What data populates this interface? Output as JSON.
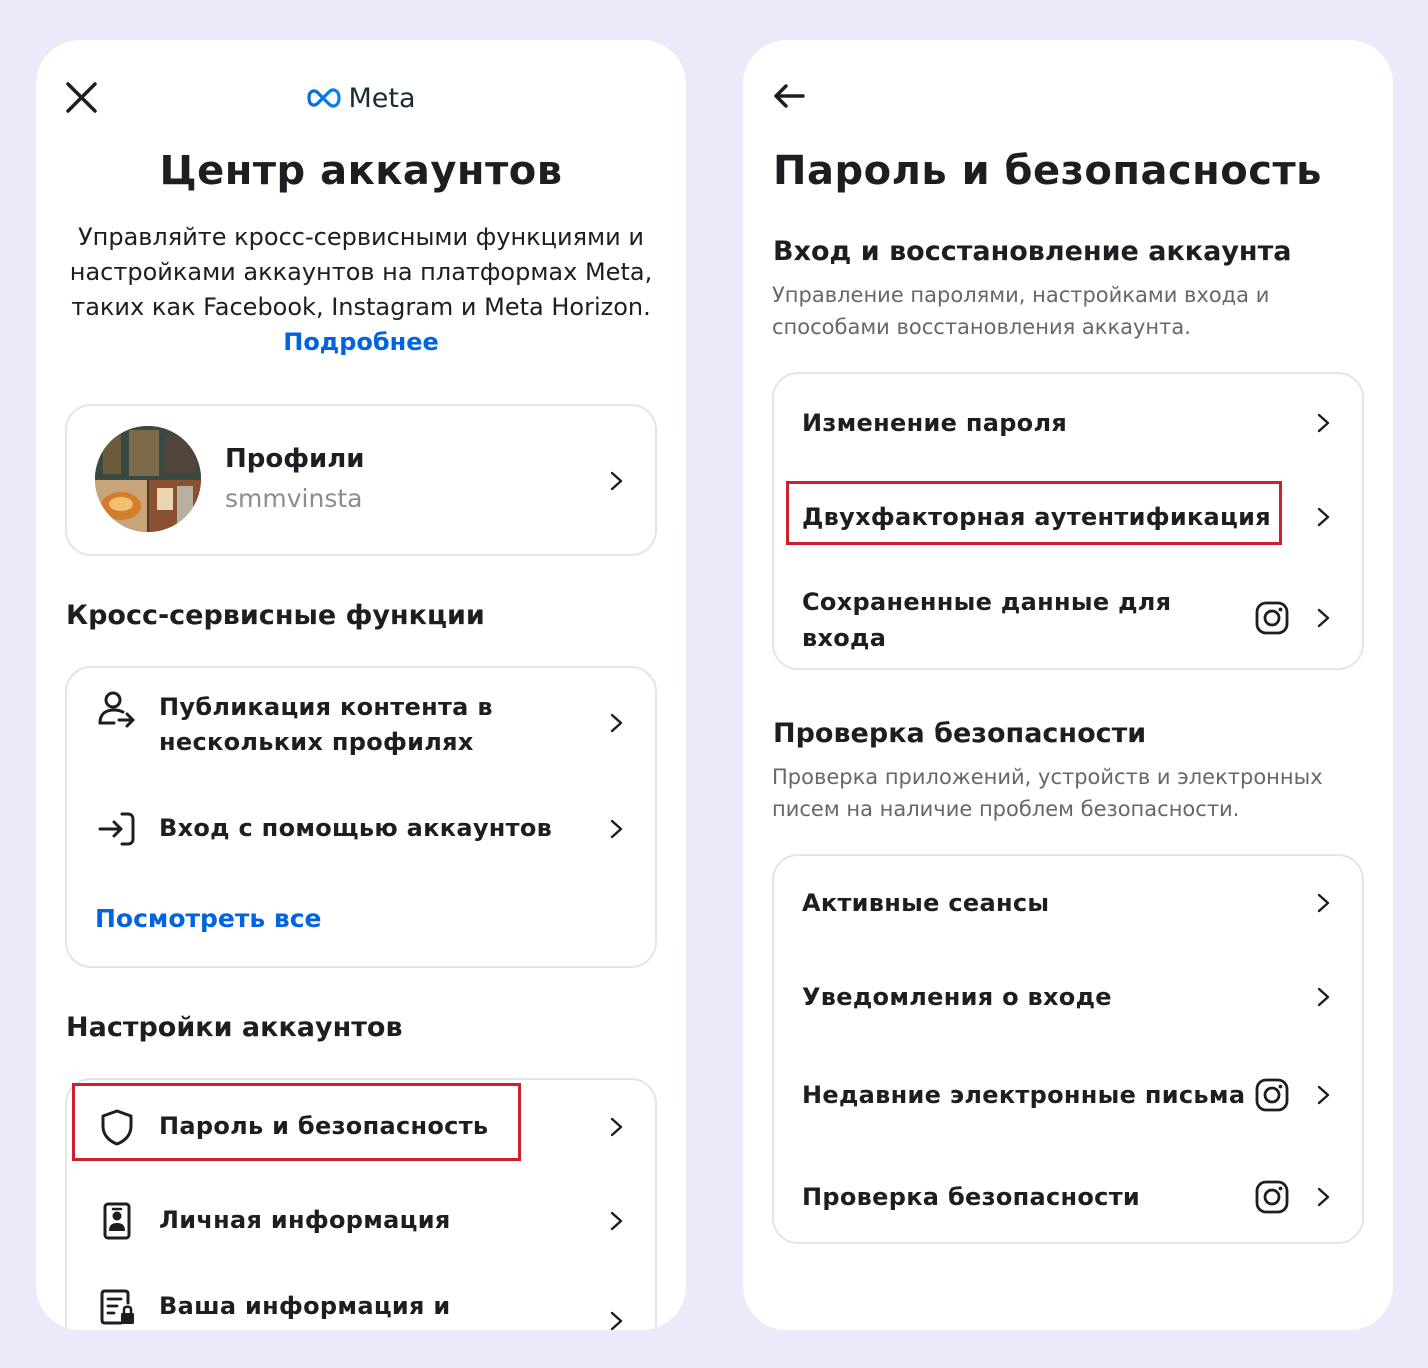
{
  "accent_color": "#0064e0",
  "highlight_color": "#d0202e",
  "left_panel": {
    "close_icon": "close-icon",
    "logo_text": "Meta",
    "title": "Центр аккаунтов",
    "description": "Управляйте кросс-сервисными функциями и настройками аккаунтов на платформах Meta, таких как Facebook, Instagram и Meta Horizon.",
    "learn_more": "Подробнее",
    "profiles_card": {
      "title": "Профили",
      "username": "smmvinsta"
    },
    "cross_section": {
      "title": "Кросс-сервисные функции",
      "items": [
        {
          "label": "Публикация контента в нескольких профилях",
          "icon": "person-share-icon"
        },
        {
          "label": "Вход с помощью аккаунтов",
          "icon": "login-arrow-icon"
        }
      ],
      "see_all": "Посмотреть все"
    },
    "settings_section": {
      "title": "Настройки аккаунтов",
      "items": [
        {
          "label": "Пароль и безопасность",
          "icon": "shield-icon"
        },
        {
          "label": "Личная информация",
          "icon": "id-card-icon"
        },
        {
          "label": "Ваша информация и",
          "icon": "document-lock-icon"
        }
      ]
    }
  },
  "right_panel": {
    "back_icon": "arrow-left-icon",
    "title": "Пароль и безопасность",
    "login_section": {
      "title": "Вход и восстановление аккаунта",
      "description": "Управление паролями, настройками входа и способами восстановления аккаунта.",
      "items": [
        {
          "label": "Изменение пароля",
          "instagram": false
        },
        {
          "label": "Двухфакторная аутентификация",
          "instagram": false
        },
        {
          "label": "Сохраненные данные для входа",
          "instagram": true
        }
      ]
    },
    "security_section": {
      "title": "Проверка безопасности",
      "description": "Проверка приложений, устройств и электронных писем на наличие проблем безопасности.",
      "items": [
        {
          "label": "Активные сеансы",
          "instagram": false
        },
        {
          "label": "Уведомления о входе",
          "instagram": false
        },
        {
          "label": "Недавние электронные письма",
          "instagram": true
        },
        {
          "label": "Проверка безопасности",
          "instagram": true
        }
      ]
    }
  }
}
